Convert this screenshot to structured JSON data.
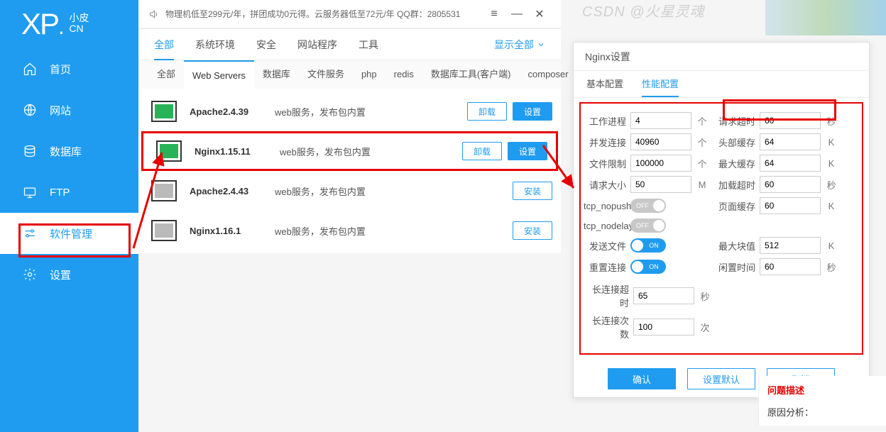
{
  "logo": {
    "prefix": "XP",
    "dot": ".",
    "small1": "小皮",
    "small2": "CN"
  },
  "nav": {
    "items": [
      {
        "label": "首页"
      },
      {
        "label": "网站"
      },
      {
        "label": "数据库"
      },
      {
        "label": "FTP"
      },
      {
        "label": "软件管理",
        "active": true
      },
      {
        "label": "设置"
      }
    ]
  },
  "titlebar": {
    "announce": "物理机低至299元/年，拼团成功0元得。云服务器低至72元/年   QQ群：2805531"
  },
  "tabs": {
    "items": [
      {
        "label": "全部",
        "active": true
      },
      {
        "label": "系统环境"
      },
      {
        "label": "安全"
      },
      {
        "label": "网站程序"
      },
      {
        "label": "工具"
      }
    ],
    "show_all": "显示全部"
  },
  "subtabs": {
    "items": [
      {
        "label": "全部"
      },
      {
        "label": "Web Servers",
        "active": true
      },
      {
        "label": "数据库"
      },
      {
        "label": "文件服务"
      },
      {
        "label": "php"
      },
      {
        "label": "redis"
      },
      {
        "label": "数据库工具(客户端)"
      },
      {
        "label": "composer"
      }
    ]
  },
  "packages": [
    {
      "name": "Apache2.4.39",
      "desc": "web服务，发布包内置",
      "btn1": "卸载",
      "btn2": "设置",
      "installed": true
    },
    {
      "name": "Nginx1.15.11",
      "desc": "web服务，发布包内置",
      "btn1": "卸载",
      "btn2": "设置",
      "installed": true,
      "highlighted": true
    },
    {
      "name": "Apache2.4.43",
      "desc": "web服务，发布包内置",
      "btn1": "安装",
      "installed": false
    },
    {
      "name": "Nginx1.16.1",
      "desc": "web服务，发布包内置",
      "btn1": "安装",
      "installed": false
    }
  ],
  "dialog": {
    "title": "Nginx设置",
    "tabs": [
      {
        "label": "基本配置"
      },
      {
        "label": "性能配置",
        "active": true
      }
    ],
    "fields": {
      "work_process": {
        "label": "工作进程",
        "value": "4",
        "unit": "个"
      },
      "request_timeout": {
        "label": "请求超时",
        "value": "60",
        "unit": "秒"
      },
      "concurrent": {
        "label": "并发连接",
        "value": "40960",
        "unit": "个"
      },
      "header_cache": {
        "label": "头部缓存",
        "value": "64",
        "unit": "K"
      },
      "file_limit": {
        "label": "文件限制",
        "value": "100000",
        "unit": "个"
      },
      "max_cache": {
        "label": "最大缓存",
        "value": "64",
        "unit": "K"
      },
      "req_size": {
        "label": "请求大小",
        "value": "50",
        "unit": "M"
      },
      "load_timeout": {
        "label": "加载超时",
        "value": "60",
        "unit": "秒"
      },
      "tcp_nopush": {
        "label": "tcp_nopush",
        "value": "OFF"
      },
      "page_cache": {
        "label": "页面缓存",
        "value": "60",
        "unit": "K"
      },
      "tcp_nodelay": {
        "label": "tcp_nodelay",
        "value": "OFF"
      },
      "send_file": {
        "label": "发送文件",
        "value": "ON"
      },
      "max_block": {
        "label": "最大块值",
        "value": "512",
        "unit": "K"
      },
      "reset_conn": {
        "label": "重置连接",
        "value": "ON"
      },
      "idle_time": {
        "label": "闲置时间",
        "value": "60",
        "unit": "秒"
      },
      "keep_timeout": {
        "label": "长连接超时",
        "value": "65",
        "unit": "秒"
      },
      "keep_count": {
        "label": "长连接次数",
        "value": "100",
        "unit": "次"
      }
    },
    "buttons": {
      "ok": "确认",
      "default": "设置默认",
      "cancel": "取消"
    }
  },
  "watermark": "CSDN @火星灵魂",
  "right_notes": {
    "hdr": "问题描述",
    "line1": "原因分析："
  }
}
